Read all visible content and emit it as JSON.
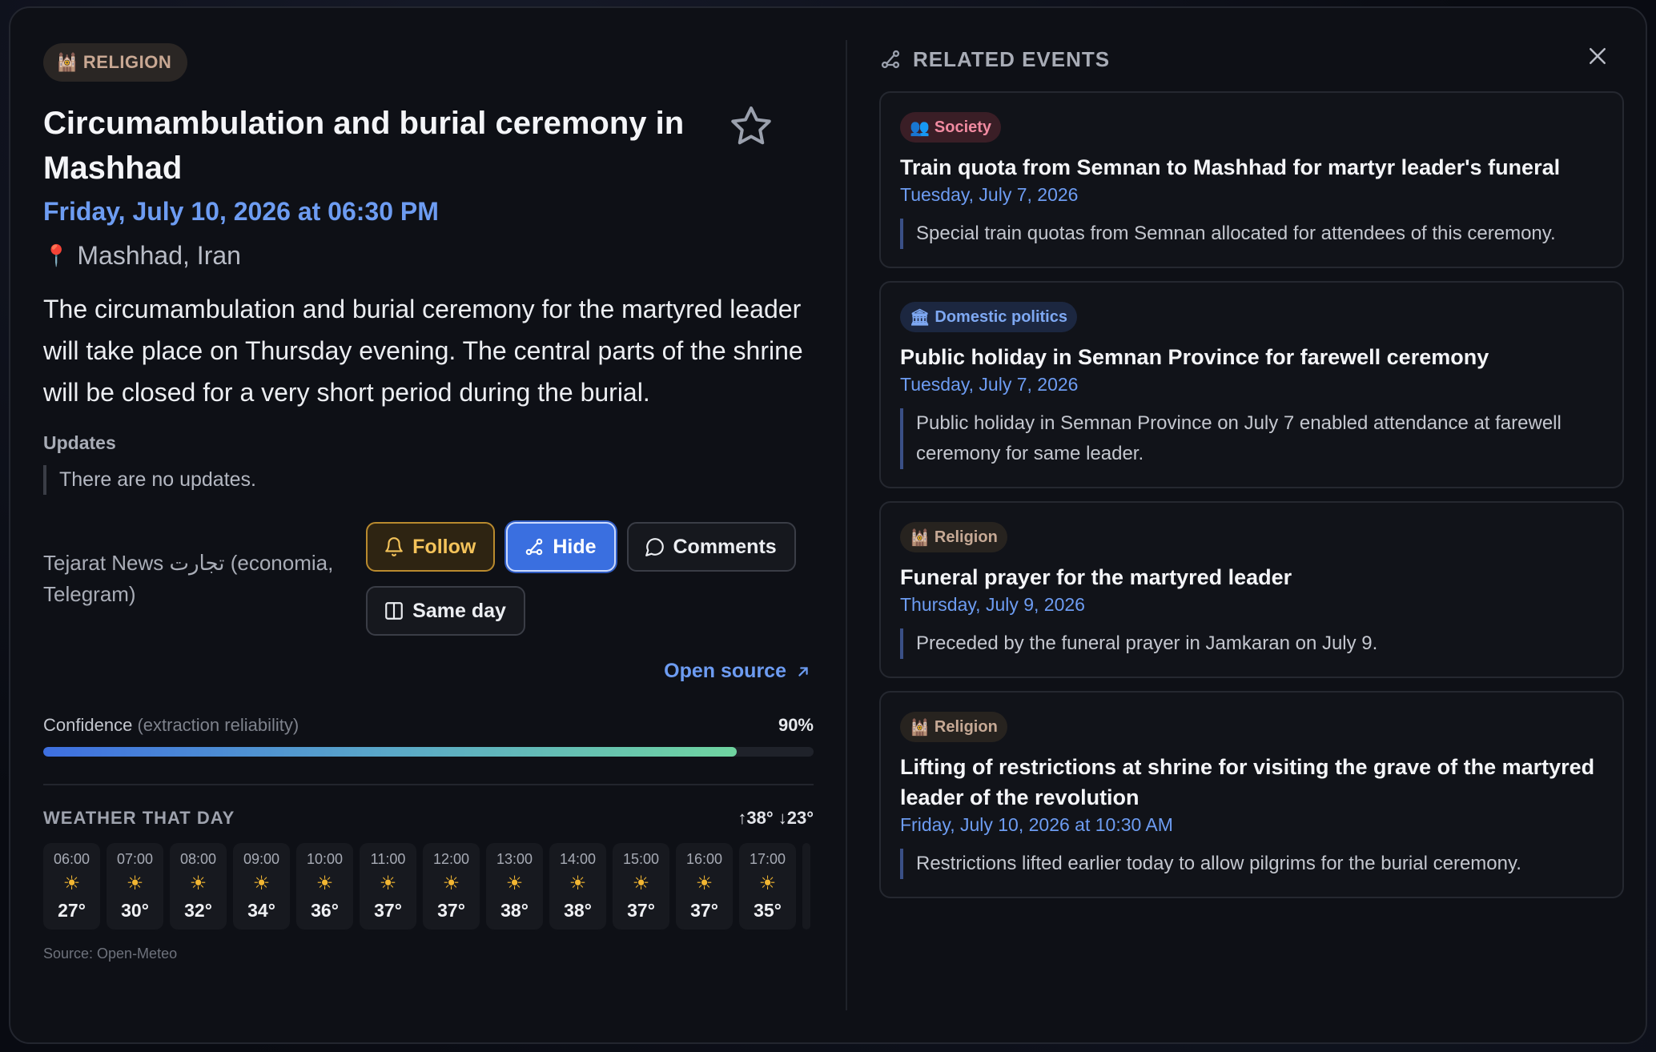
{
  "event": {
    "category": "RELIGION",
    "category_icon": "🕍",
    "title": "Circumambulation and burial ceremony in Mashhad",
    "date": "Friday, July 10, 2026 at 06:30 PM",
    "location": "Mashhad, Iran",
    "description": "The circumambulation and burial ceremony for the martyred leader will take place on Thursday evening. The central parts of the shrine will be closed for a very short period during the burial.",
    "updates_heading": "Updates",
    "updates_text": "There are no updates.",
    "source": "Tejarat News تجارت (economia, Telegram)",
    "buttons": {
      "follow": "Follow",
      "hide": "Hide",
      "comments": "Comments",
      "same_day": "Same day"
    },
    "open_source": "Open source",
    "confidence": {
      "label": "Confidence",
      "sublabel": "(extraction reliability)",
      "value_text": "90%",
      "value": 0.9
    }
  },
  "weather": {
    "title": "WEATHER THAT DAY",
    "hilo": "↑38° ↓23°",
    "hours": [
      {
        "time": "06:00",
        "temp": "27°"
      },
      {
        "time": "07:00",
        "temp": "30°"
      },
      {
        "time": "08:00",
        "temp": "32°"
      },
      {
        "time": "09:00",
        "temp": "34°"
      },
      {
        "time": "10:00",
        "temp": "36°"
      },
      {
        "time": "11:00",
        "temp": "37°"
      },
      {
        "time": "12:00",
        "temp": "37°"
      },
      {
        "time": "13:00",
        "temp": "38°"
      },
      {
        "time": "14:00",
        "temp": "38°"
      },
      {
        "time": "15:00",
        "temp": "37°"
      },
      {
        "time": "16:00",
        "temp": "37°"
      },
      {
        "time": "17:00",
        "temp": "35°"
      }
    ],
    "source": "Source: Open-Meteo"
  },
  "related": {
    "heading": "RELATED EVENTS",
    "items": [
      {
        "category": "Society",
        "icon": "👥",
        "title": "Train quota from Semnan to Mashhad for martyr leader's funeral",
        "date": "Tuesday, July 7, 2026",
        "description": "Special train quotas from Semnan allocated for attendees of this ceremony."
      },
      {
        "category": "Domestic politics",
        "icon": "🏛",
        "title": "Public holiday in Semnan Province for farewell ceremony",
        "date": "Tuesday, July 7, 2026",
        "description": "Public holiday in Semnan Province on July 7 enabled attendance at farewell ceremony for same leader."
      },
      {
        "category": "Religion",
        "icon": "🕍",
        "title": "Funeral prayer for the martyred leader",
        "date": "Thursday, July 9, 2026",
        "description": "Preceded by the funeral prayer in Jamkaran on July 9."
      },
      {
        "category": "Religion",
        "icon": "🕍",
        "title": "Lifting of restrictions at shrine for visiting the grave of the martyred leader of the revolution",
        "date": "Friday, July 10, 2026 at 10:30 AM",
        "description": "Restrictions lifted earlier today to allow pilgrims for the burial ceremony."
      }
    ]
  }
}
